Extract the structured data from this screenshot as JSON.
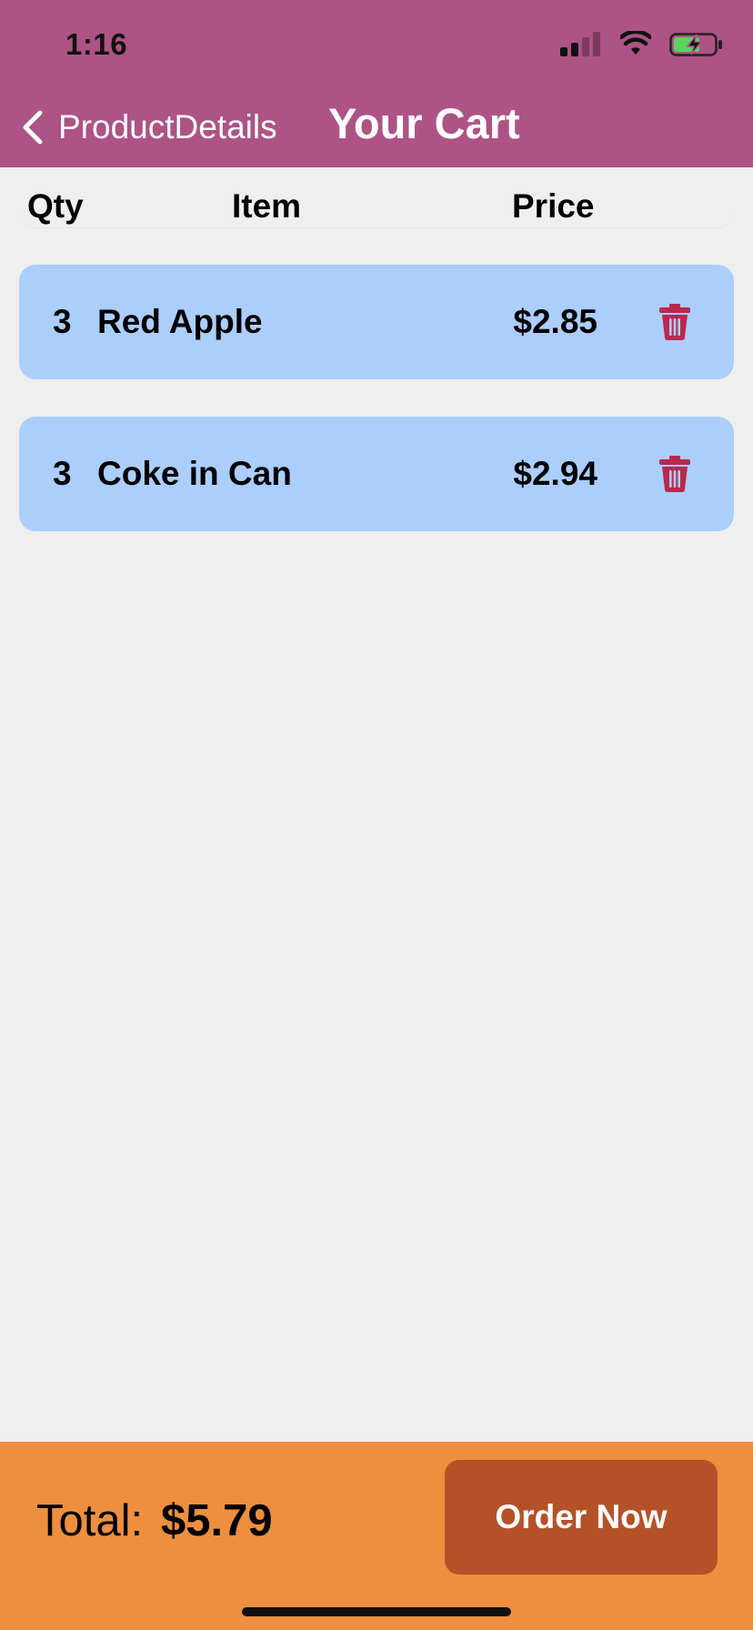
{
  "status_bar": {
    "time": "1:16",
    "icons": [
      "signal-icon",
      "wifi-icon",
      "battery-charging-icon"
    ]
  },
  "nav": {
    "back_label": "ProductDetails",
    "back_icon": "chevron-left-icon",
    "title": "Your Cart"
  },
  "table": {
    "headers": {
      "qty": "Qty",
      "item": "Item",
      "price": "Price"
    },
    "rows": [
      {
        "qty": "3",
        "name": "Red Apple",
        "price": "$2.85",
        "action_icon": "trash-icon"
      },
      {
        "qty": "3",
        "name": "Coke in Can",
        "price": "$2.94",
        "action_icon": "trash-icon"
      }
    ]
  },
  "footer": {
    "total_label": "Total:",
    "total_value": "$5.79",
    "order_button": "Order Now"
  },
  "colors": {
    "header_bg": "#ad5386",
    "row_bg": "#abcefc",
    "trash": "#b8294d",
    "footer_bg": "#ed8f3f",
    "order_button_bg": "#b55128",
    "page_bg": "#efefef"
  }
}
